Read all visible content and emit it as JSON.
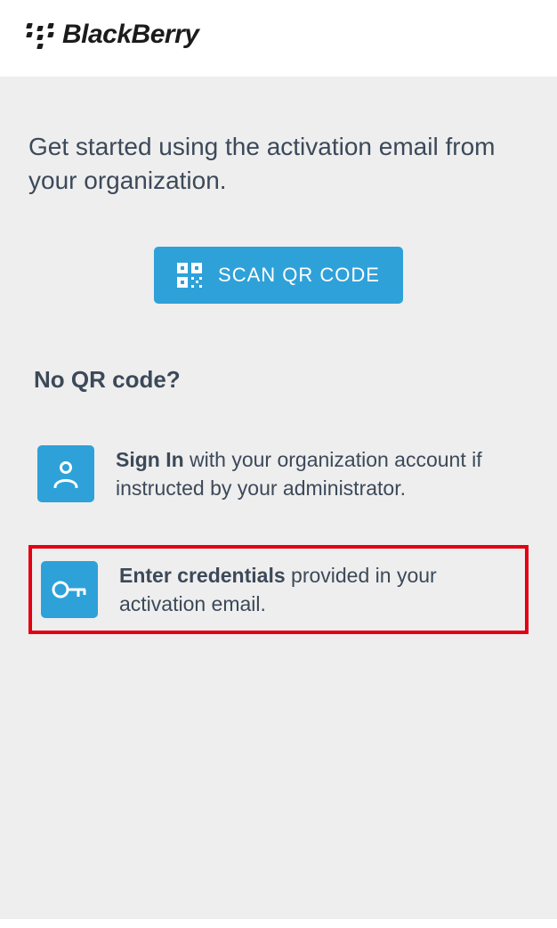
{
  "header": {
    "brand": "BlackBerry"
  },
  "intro": "Get started using the activation email from your organization.",
  "scan_button_label": "SCAN QR CODE",
  "sub_heading": "No QR code?",
  "options": {
    "sign_in": {
      "strong": "Sign In",
      "rest": " with your organization account if instructed by your administrator."
    },
    "enter_credentials": {
      "strong": "Enter credentials",
      "rest": " provided in your activation email."
    }
  }
}
